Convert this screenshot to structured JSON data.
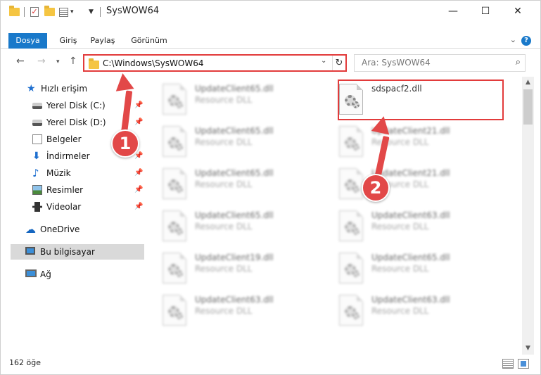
{
  "window": {
    "title": "SysWOW64",
    "controls": {
      "minimize": "—",
      "maximize": "☐",
      "close": "✕"
    }
  },
  "ribbon": {
    "tabs": [
      {
        "label": "Dosya",
        "active": true
      },
      {
        "label": "Giriş"
      },
      {
        "label": "Paylaş"
      },
      {
        "label": "Görünüm"
      }
    ],
    "help": "?"
  },
  "nav": {
    "address": "C:\\Windows\\SysWOW64",
    "search_placeholder": "Ara: SysWOW64"
  },
  "sidebar": {
    "items": [
      {
        "label": "Hızlı erişim"
      },
      {
        "label": "Yerel Disk (C:)"
      },
      {
        "label": "Yerel Disk (D:)"
      },
      {
        "label": "Belgeler"
      },
      {
        "label": "İndirmeler"
      },
      {
        "label": "Müzik"
      },
      {
        "label": "Resimler"
      },
      {
        "label": "Videolar"
      },
      {
        "label": "OneDrive"
      },
      {
        "label": "Bu bilgisayar",
        "selected": true
      },
      {
        "label": "Ağ"
      }
    ]
  },
  "files": [
    {
      "name": "UpdateClient65.dll",
      "type": "Resource DLL"
    },
    {
      "name": "sdspacf2.dll",
      "type": ""
    },
    {
      "name": "UpdateClient65.dll",
      "type": "Resource DLL"
    },
    {
      "name": "UpdateClient21.dll",
      "type": "Resource DLL"
    },
    {
      "name": "UpdateClient65.dll",
      "type": "Resource DLL"
    },
    {
      "name": "UpdateClient21.dll",
      "type": "Resource DLL"
    },
    {
      "name": "UpdateClient65.dll",
      "type": "Resource DLL"
    },
    {
      "name": "UpdateClient63.dll",
      "type": "Resource DLL"
    },
    {
      "name": "UpdateClient19.dll",
      "type": "Resource DLL"
    },
    {
      "name": "UpdateClient65.dll",
      "type": "Resource DLL"
    },
    {
      "name": "UpdateClient63.dll",
      "type": "Resource DLL"
    },
    {
      "name": "UpdateClient63.dll",
      "type": "Resource DLL"
    }
  ],
  "status": {
    "count": "162 öğe"
  },
  "annotations": {
    "badge1": "1",
    "badge2": "2",
    "color": "#e24848"
  }
}
